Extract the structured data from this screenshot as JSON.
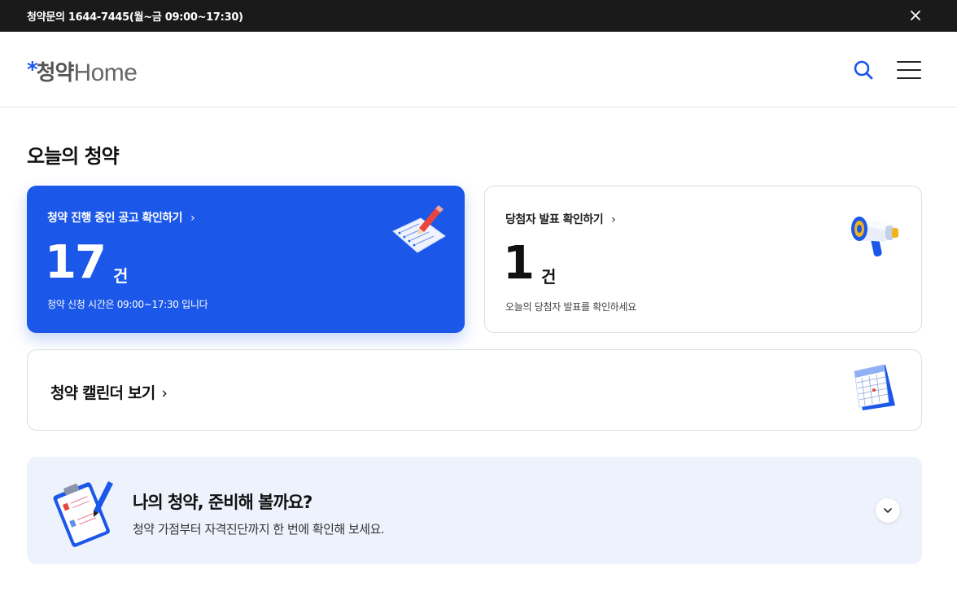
{
  "topbar": {
    "notice": "청약문의 1644-7445(월~금 09:00~17:30)",
    "close_icon": "close-icon"
  },
  "header": {
    "logo_star": "*",
    "logo_kor": "청약",
    "logo_eng": "Home",
    "search_icon": "search-icon",
    "menu_icon": "hamburger-menu-icon",
    "accent_color": "#1b57e8"
  },
  "main": {
    "section_title": "오늘의 청약",
    "ongoing_card": {
      "title": "청약 진행 중인 공고 확인하기",
      "chevron": "›",
      "count": "17",
      "unit": "건",
      "desc": "청약 신청 시간은 09:00~17:30 입니다",
      "bg_color": "#1b57e8",
      "icon": "application-form-pencil-icon"
    },
    "winner_card": {
      "title": "당첨자 발표 확인하기",
      "chevron": "›",
      "count": "1",
      "unit": "건",
      "desc": "오늘의 당첨자 발표를 확인하세요",
      "icon": "megaphone-icon"
    },
    "calendar_card": {
      "label": "청약 캘린더 보기",
      "chevron": "›",
      "icon": "calendar-icon"
    },
    "prep_card": {
      "title": "나의 청약, 준비해 볼까요?",
      "subtitle": "청약 가점부터 자격진단까지 한 번에 확인해 보세요.",
      "icon": "clipboard-checklist-icon",
      "expand_icon": "chevron-down-icon",
      "bg_color": "#eef2fc"
    }
  }
}
